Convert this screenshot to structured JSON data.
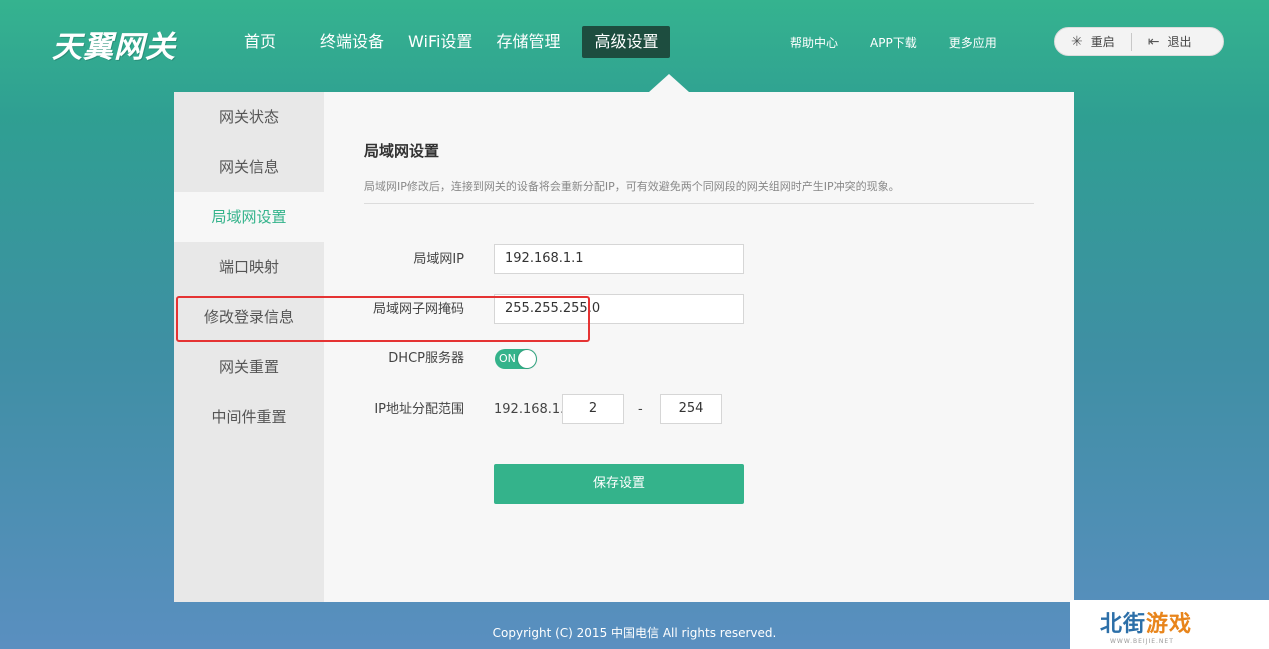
{
  "header": {
    "logo": "天翼网关",
    "nav": [
      {
        "label": "首页",
        "active": false
      },
      {
        "label": "终端设备",
        "active": false
      },
      {
        "label": "WiFi设置",
        "active": false
      },
      {
        "label": "存储管理",
        "active": false
      },
      {
        "label": "高级设置",
        "active": true
      }
    ],
    "links": [
      "帮助中心",
      "APP下载",
      "更多应用"
    ],
    "restart_label": "重启",
    "logout_label": "退出"
  },
  "sidebar": {
    "items": [
      {
        "label": "网关状态",
        "active": false
      },
      {
        "label": "网关信息",
        "active": false
      },
      {
        "label": "局域网设置",
        "active": true
      },
      {
        "label": "端口映射",
        "active": false
      },
      {
        "label": "修改登录信息",
        "active": false
      },
      {
        "label": "网关重置",
        "active": false
      },
      {
        "label": "中间件重置",
        "active": false
      }
    ]
  },
  "main": {
    "title": "局域网设置",
    "description": "局域网IP修改后，连接到网关的设备将会重新分配IP，可有效避免两个同网段的网关组网时产生IP冲突的现象。",
    "lan_ip_label": "局域网IP",
    "lan_ip_value": "192.168.1.1",
    "subnet_label": "局域网子网掩码",
    "subnet_value": "255.255.255.0",
    "dhcp_label": "DHCP服务器",
    "dhcp_state": "ON",
    "range_label": "IP地址分配范围",
    "range_prefix": "192.168.1.",
    "range_start": "2",
    "range_separator": "-",
    "range_end": "254",
    "save_label": "保存设置"
  },
  "footer": {
    "copyright": "Copyright (C) 2015 中国电信 All rights reserved."
  },
  "watermark": {
    "brand_a": "北街",
    "brand_b": "游戏",
    "sub": "WWW.BEIJIE.NET"
  },
  "colors": {
    "accent": "#34b38b",
    "nav_active": "#1d4d3f",
    "highlight": "#e53333"
  }
}
